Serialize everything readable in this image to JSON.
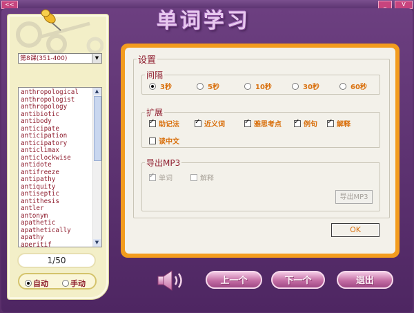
{
  "window": {
    "left_button": "<<",
    "right_button_1": "_",
    "right_button_2": "V",
    "title": "单词学习"
  },
  "sidebar": {
    "lesson_select": "第8课(351-400)",
    "words": [
      "anthropological",
      "anthropologist",
      "anthropology",
      "antibiotic",
      "antibody",
      "anticipate",
      "anticipation",
      "anticipatory",
      "anticlimax",
      "anticlockwise",
      "antidote",
      "antifreeze",
      "antipathy",
      "antiquity",
      "antiseptic",
      "antithesis",
      "antler",
      "antonym",
      "apathetic",
      "apathetically",
      "apathy",
      "aperitif"
    ],
    "counter": "1/50",
    "mode_auto": "自动",
    "mode_manual": "手动",
    "mode_selected": "自动"
  },
  "settings": {
    "title": "设置",
    "interval": {
      "legend": "间隔",
      "options": [
        "3秒",
        "5秒",
        "10秒",
        "30秒",
        "60秒"
      ],
      "selected": "3秒"
    },
    "extend": {
      "legend": "扩展",
      "options": [
        {
          "label": "助记法",
          "checked": true
        },
        {
          "label": "近义词",
          "checked": true
        },
        {
          "label": "雅思考点",
          "checked": true
        },
        {
          "label": "例句",
          "checked": true
        },
        {
          "label": "解释",
          "checked": true
        },
        {
          "label": "读中文",
          "checked": false
        }
      ]
    },
    "export": {
      "legend": "导出MP3",
      "word": {
        "label": "单词",
        "checked": true
      },
      "explain": {
        "label": "解释",
        "checked": false
      },
      "button": "导出MP3"
    },
    "ok": "OK"
  },
  "bottom": {
    "prev": "上一个",
    "next": "下一个",
    "exit": "退出"
  },
  "icons": {
    "speaker": "speaker-icon",
    "pin": "pushpin-icon"
  }
}
